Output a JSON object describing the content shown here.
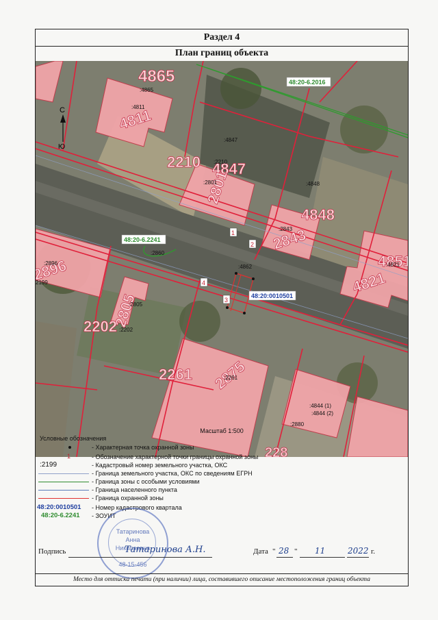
{
  "section_title": "Раздел 4",
  "plan_title": "План границ объекта",
  "compass": {
    "north": "С",
    "south": "Ю"
  },
  "map_labels": {
    "zone_6_2016": "48:20-6.2016",
    "zone_6_2241": "48:20-6.2241",
    "quarter": "48:20:0010501",
    "big_4865": "4865",
    "small_4865": ":4865",
    "big_4811": "4811",
    "small_4811": ":4811",
    "big_4847": "4847",
    "small_4847": ":4847",
    "big_2210": "2210",
    "small_2210": ":2210",
    "big_2801": "2801",
    "small_2801": ":2801",
    "big_4848": "4848",
    "small_4848": ":4848",
    "big_2843": "2843",
    "small_2843": ":2843",
    "big_4821": "4821",
    "small_4821": ":4821",
    "big_4851": "4851",
    "big_2896": "2896",
    "small_2896": ":2896",
    "small_2199": "2199",
    "big_2805": "2805",
    "small_2805": ":2805",
    "big_2202": "2202",
    "small_2202": ":2202",
    "big_2261": "2261",
    "small_2261": ":2261",
    "big_2875": "2875",
    "small_4862": ":4862",
    "small_2860": ":2860",
    "small_4844_1": ":4844 (1)",
    "small_4844_2": ":4844 (2)",
    "small_2880": ":2880",
    "big_2280": "228",
    "point_1": "1",
    "point_2": "2",
    "point_3": "3",
    "point_4": "4"
  },
  "scale": "Масштаб 1:500",
  "legend": {
    "title": "Условные обозначения",
    "rows": [
      {
        "text": "- Характерная точка охранной зоны"
      },
      {
        "symbol": "1",
        "text": "- Обозначение характерной точки границы охранной зоны"
      },
      {
        "symbol": ":2199",
        "text": "- Кадастровый номер земельного участка, ОКС"
      },
      {
        "text": "- Граница земельного участка, ОКС по сведениям ЕГРН"
      },
      {
        "text": "- Граница зоны с особыми условиями"
      },
      {
        "text": "- Граница населенного пункта"
      },
      {
        "text": "- Граница охранной зоны"
      },
      {
        "symbol": "48:20:0010501",
        "text": "- Номер кадастрового квартала"
      },
      {
        "symbol": "48:20-6.2241",
        "text": "- ЗОУИТ"
      }
    ]
  },
  "signature": {
    "label": "Подпись",
    "handwritten": "Татаринова А.Н.",
    "date_label": "Дата",
    "day": "28",
    "month": "11",
    "year": "2022",
    "year_suffix": "г."
  },
  "stamp": {
    "name_line1": "Татаринова",
    "name_line2": "Анна",
    "name_line3": "Николаевна",
    "number": "48-15-456"
  },
  "footer": "Место для оттиска печати (при наличии) лица, составившего описание местоположения границ объекта",
  "colors": {
    "parcel_line": "#e0203a",
    "building": "#f0a4a8",
    "zone": "#2e8b2e",
    "guard_zone": "#e03030",
    "quarter_text": "#1f3fa0"
  }
}
